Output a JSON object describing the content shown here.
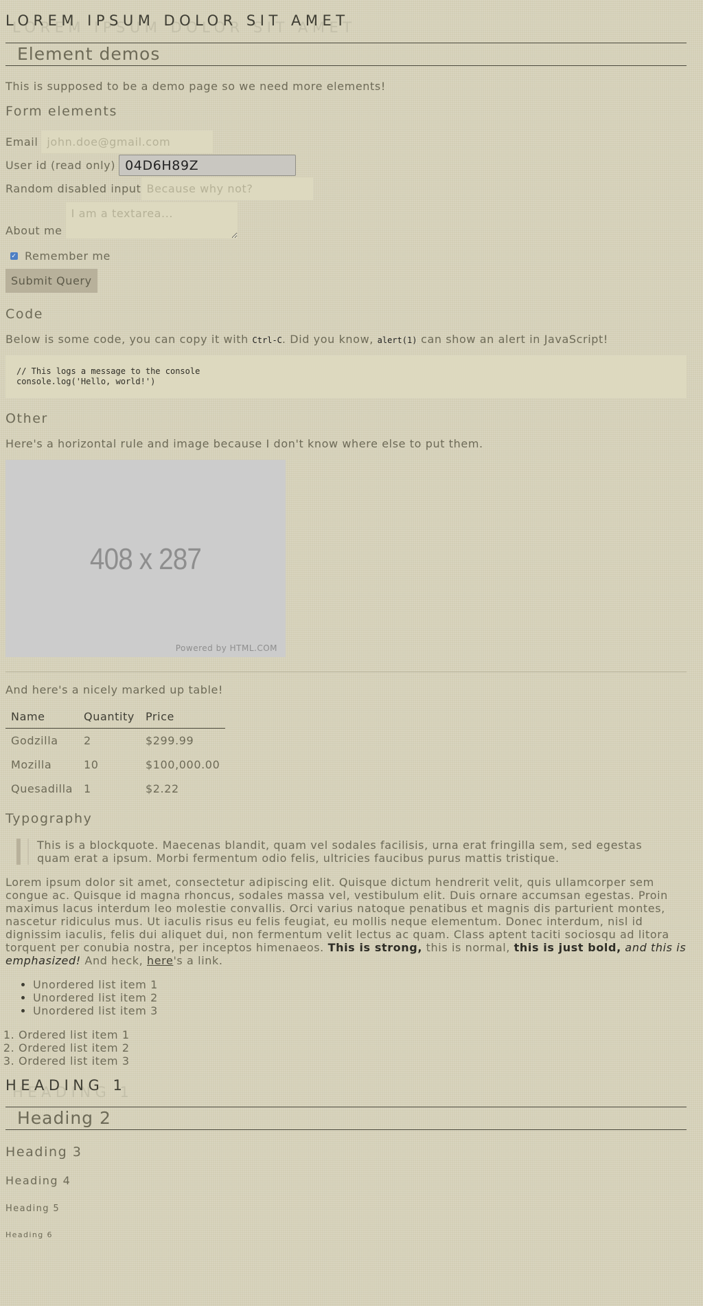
{
  "site_title": "Lorem ipsum dolor sit amet",
  "section_title": "Element demos",
  "intro": "This is supposed to be a demo page so we need more elements!",
  "form": {
    "heading": "Form elements",
    "email_label": "Email",
    "email_placeholder": "john.doe@gmail.com",
    "userid_label": "User id (read only)",
    "userid_value": "04D6H89Z",
    "disabled_label": "Random disabled input",
    "disabled_placeholder": "Because why not?",
    "about_label": "About me",
    "about_placeholder": "I am a textarea...",
    "remember_label": "Remember me",
    "remember_checked": true,
    "submit_label": "Submit Query"
  },
  "code": {
    "heading": "Code",
    "text_before": "Below is some code, you can copy it with ",
    "shortcut": "Ctrl-C",
    "text_middle": ". Did you know, ",
    "inline_code": "alert(1)",
    "text_after": " can show an alert in JavaScript!",
    "line1": "// This logs a message to the console",
    "line2": "console.log('Hello, world!')"
  },
  "other": {
    "heading": "Other",
    "text": "Here's a horizontal rule and image because I don't know where else to put them.",
    "image_label": "408 x 287",
    "image_credit": "Powered by HTML.COM",
    "table_intro": "And here's a nicely marked up table!"
  },
  "table": {
    "headers": [
      "Name",
      "Quantity",
      "Price"
    ],
    "rows": [
      [
        "Godzilla",
        "2",
        "$299.99"
      ],
      [
        "Mozilla",
        "10",
        "$100,000.00"
      ],
      [
        "Quesadilla",
        "1",
        "$2.22"
      ]
    ]
  },
  "typography": {
    "heading": "Typography",
    "blockquote": "This is a blockquote. Maecenas blandit, quam vel sodales facilisis, urna erat fringilla sem, sed egestas quam erat a ipsum. Morbi fermentum odio felis, ultricies faucibus purus mattis tristique.",
    "paragraph": "Lorem ipsum dolor sit amet, consectetur adipiscing elit. Quisque dictum hendrerit velit, quis ullamcorper sem congue ac. Quisque id magna rhoncus, sodales massa vel, vestibulum elit. Duis ornare accumsan egestas. Proin maximus lacus interdum leo molestie convallis. Orci varius natoque penatibus et magnis dis parturient montes, nascetur ridiculus mus. Ut iaculis risus eu felis feugiat, eu mollis neque elementum. Donec interdum, nisl id dignissim iaculis, felis dui aliquet dui, non fermentum velit lectus ac quam. Class aptent taciti sociosqu ad litora torquent per conubia nostra, per inceptos himenaeos. ",
    "strong": "This is strong,",
    "normal": " this is normal, ",
    "bold": "this is just bold,",
    "em": " and this is emphasized!",
    "heck": " And heck, ",
    "link": "here",
    "link_after": "'s a link.",
    "unordered": [
      "Unordered list item 1",
      "Unordered list item 2",
      "Unordered list item 3"
    ],
    "ordered": [
      "Ordered list item 1",
      "Ordered list item 2",
      "Ordered list item 3"
    ]
  },
  "headings": {
    "h1": "Heading 1",
    "h2": "Heading 2",
    "h3": "Heading 3",
    "h4": "Heading 4",
    "h5": "Heading 5",
    "h6": "Heading 6"
  }
}
